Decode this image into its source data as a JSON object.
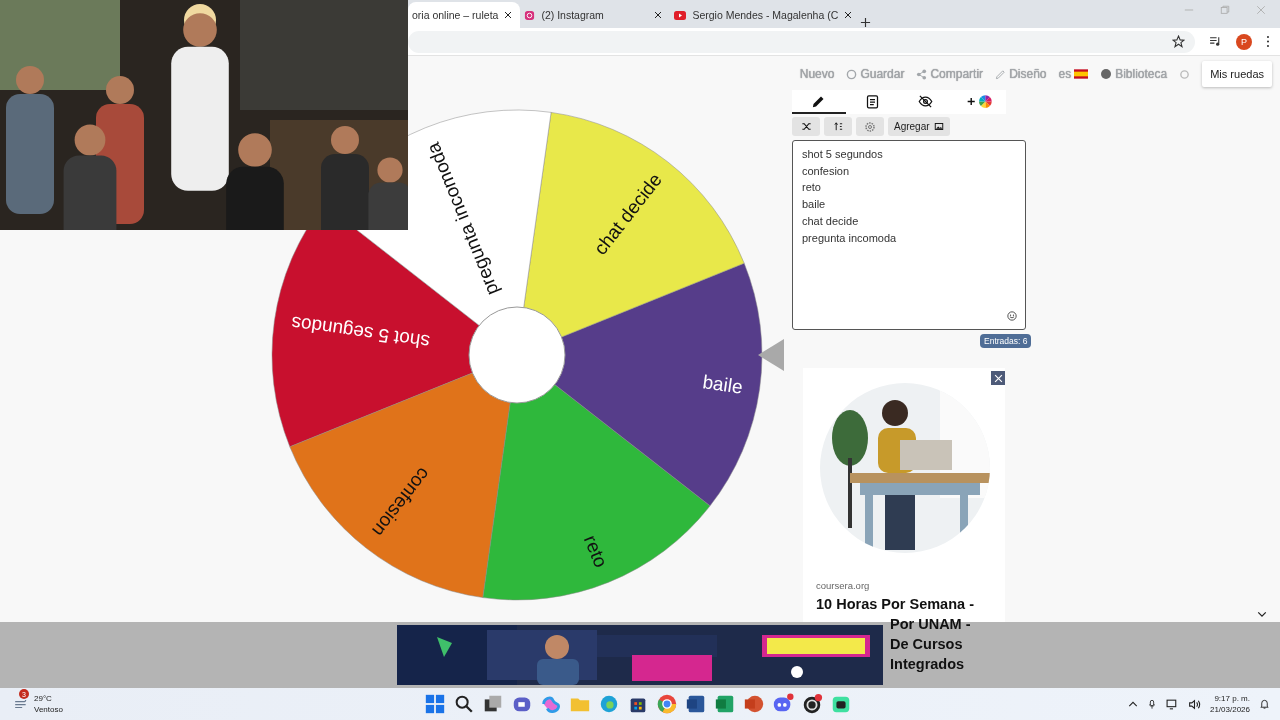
{
  "browser": {
    "tabs": [
      {
        "title": "oria online – ruleta",
        "kind": "page",
        "selected": true
      },
      {
        "title": "(2) Instagram",
        "kind": "instagram",
        "selected": false
      },
      {
        "title": "Sergio Mendes - Magalenha (C",
        "kind": "video",
        "selected": false
      }
    ],
    "profile_initial": "P"
  },
  "toolbar": {
    "items": [
      {
        "label": "Nuevo",
        "kind": "new"
      },
      {
        "label": "Guardar",
        "kind": "save"
      },
      {
        "label": "Compartir",
        "kind": "share"
      },
      {
        "label": "Diseño",
        "kind": "design"
      },
      {
        "label": "es",
        "kind": "language"
      },
      {
        "label": "Biblioteca",
        "kind": "library"
      }
    ],
    "my_wheels": "Mis ruedas"
  },
  "editor": {
    "tabs": [
      {
        "kind": "edit",
        "selected": true
      },
      {
        "kind": "results",
        "selected": false
      },
      {
        "kind": "hide",
        "selected": false
      },
      {
        "kind": "add_color",
        "selected": false
      }
    ],
    "buttons": [
      {
        "kind": "shuffle"
      },
      {
        "kind": "sort"
      },
      {
        "kind": "advanced"
      },
      {
        "kind": "add_image",
        "label": "Agregar"
      }
    ],
    "entries": [
      "shot 5 segundos",
      "confesion",
      "reto",
      "baile",
      "chat decide",
      "pregunta incomoda"
    ],
    "entry_count": "Entradas: 6"
  },
  "wheel": {
    "segments": [
      {
        "label": "shot 5 segundos",
        "color": "#c8102e"
      },
      {
        "label": "confesion",
        "color": "#e0731a"
      },
      {
        "label": "reto",
        "color": "#2fb83c"
      },
      {
        "label": "baile",
        "color": "#563d8a"
      },
      {
        "label": "chat decide",
        "color": "#e8e84a"
      },
      {
        "label": "pregunta incomoda",
        "color": "#ffffff"
      }
    ]
  },
  "ad_card": {
    "source": "coursera.org",
    "title_lines": [
      "10 Horas Por Semana -",
      "Por UNAM -",
      "De Cursos",
      "Integrados"
    ]
  },
  "taskbar": {
    "weather": {
      "badge": "3",
      "temperature": "29°C",
      "condition": "Ventoso"
    },
    "time": "9:17 p. m.",
    "date": "21/03/2026"
  }
}
